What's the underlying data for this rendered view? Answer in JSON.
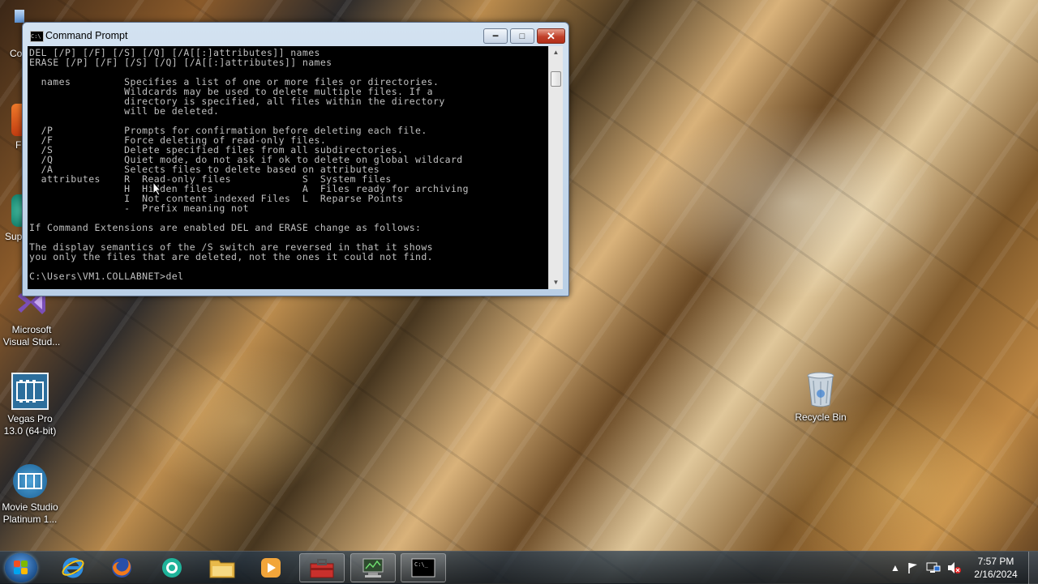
{
  "window": {
    "title": "Command Prompt",
    "icon": "cmd-window-icon",
    "controls": {
      "minimize": "minimize-icon",
      "maximize": "maximize-icon",
      "close": "close-icon"
    }
  },
  "console_lines": [
    "DEL [/P] [/F] [/S] [/Q] [/A[[:]attributes]] names",
    "ERASE [/P] [/F] [/S] [/Q] [/A[[:]attributes]] names",
    "",
    "  names         Specifies a list of one or more files or directories.",
    "                Wildcards may be used to delete multiple files. If a",
    "                directory is specified, all files within the directory",
    "                will be deleted.",
    "",
    "  /P            Prompts for confirmation before deleting each file.",
    "  /F            Force deleting of read-only files.",
    "  /S            Delete specified files from all subdirectories.",
    "  /Q            Quiet mode, do not ask if ok to delete on global wildcard",
    "  /A            Selects files to delete based on attributes",
    "  attributes    R  Read-only files            S  System files",
    "                H  Hidden files               A  Files ready for archiving",
    "                I  Not content indexed Files  L  Reparse Points",
    "                -  Prefix meaning not",
    "",
    "If Command Extensions are enabled DEL and ERASE change as follows:",
    "",
    "The display semantics of the /S switch are reversed in that it shows",
    "you only the files that are deleted, not the ones it could not find.",
    "",
    "C:\\Users\\VM1.COLLABNET>del"
  ],
  "desktop": {
    "icons": [
      {
        "name": "Microsoft Visual Stud...",
        "icon": "visual-studio-icon"
      },
      {
        "name": "Vegas Pro 13.0 (64-bit)",
        "icon": "vegas-pro-icon"
      },
      {
        "name": "Movie Studio Platinum 1...",
        "icon": "movie-studio-icon"
      },
      {
        "name": "Recycle Bin",
        "icon": "recycle-bin-icon"
      }
    ],
    "edge_fragments": [
      "Co",
      "F",
      "Sup"
    ]
  },
  "taskbar": {
    "items": [
      {
        "icon": "internet-explorer-icon"
      },
      {
        "icon": "firefox-icon"
      },
      {
        "icon": "skype-icon"
      },
      {
        "icon": "file-explorer-icon"
      },
      {
        "icon": "media-player-icon"
      },
      {
        "icon": "toolbox-app-icon",
        "open": true
      },
      {
        "icon": "network-app-icon",
        "open": true
      },
      {
        "icon": "command-prompt-icon",
        "open": true
      }
    ],
    "tray_icons": [
      "show-hidden-icons-icon",
      "action-center-flag-icon",
      "network-icon",
      "volume-muted-icon"
    ],
    "clock_time": "7:57 PM",
    "clock_date": "2/16/2024"
  },
  "colors": {
    "console_bg": "#000000",
    "console_fg": "#c0c0c0",
    "close_red": "#c0402a"
  }
}
